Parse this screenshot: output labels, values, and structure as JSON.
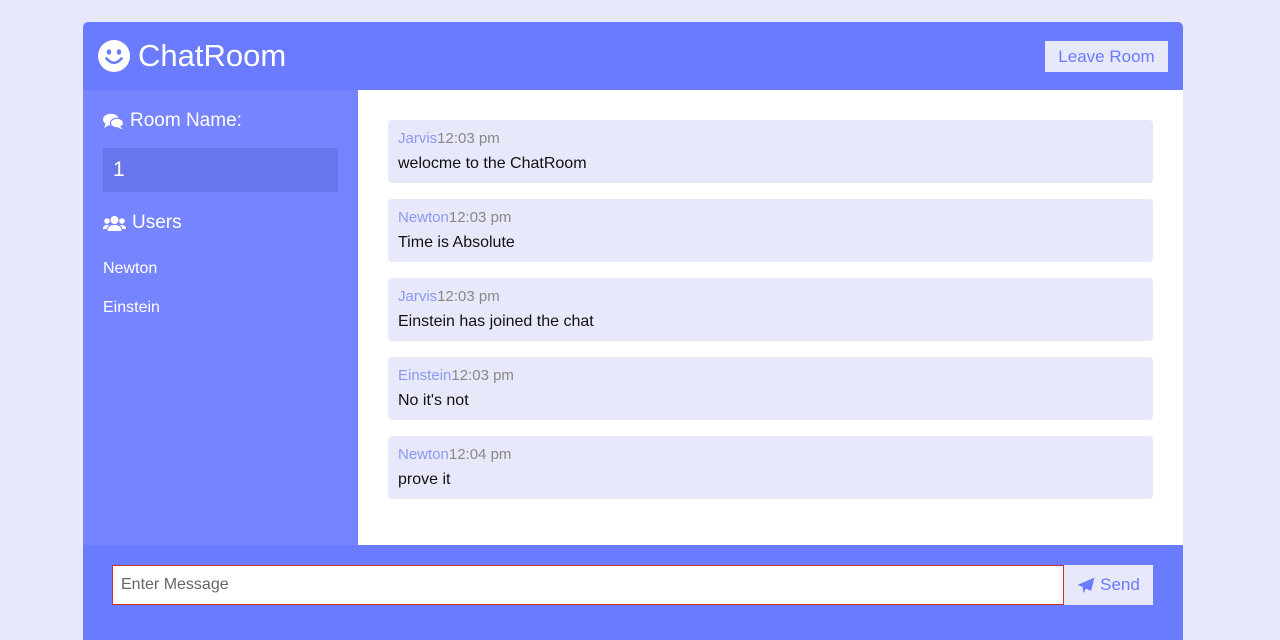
{
  "header": {
    "title": "ChatRoom",
    "leave_label": "Leave Room",
    "brand_icon": "smile-icon"
  },
  "sidebar": {
    "room_heading": "Room Name:",
    "room_name": "1",
    "users_heading": "Users",
    "users": [
      "Newton",
      "Einstein"
    ]
  },
  "messages": [
    {
      "user": "Jarvis",
      "time": "12:03 pm",
      "text": "welocme to the ChatRoom"
    },
    {
      "user": "Newton",
      "time": "12:03 pm",
      "text": "Time is Absolute"
    },
    {
      "user": "Jarvis",
      "time": "12:03 pm",
      "text": "Einstein has joined the chat"
    },
    {
      "user": "Einstein",
      "time": "12:03 pm",
      "text": "No it's not"
    },
    {
      "user": "Newton",
      "time": "12:04 pm",
      "text": "prove it"
    }
  ],
  "form": {
    "placeholder": "Enter Message",
    "value": "",
    "send_label": "Send"
  },
  "colors": {
    "primary": "#6a7bff",
    "sidebar": "#7684ff",
    "light": "#e8e8fb",
    "room_box": "#6975ea"
  }
}
